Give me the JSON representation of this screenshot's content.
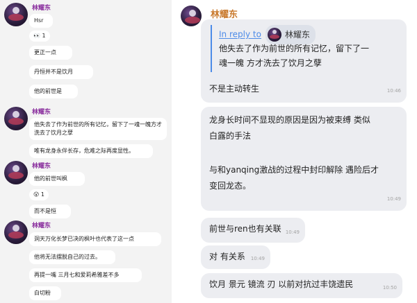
{
  "left": {
    "author": "林耀东",
    "messages": [
      {
        "text": "Hsr"
      },
      {
        "text": "更正一点"
      },
      {
        "text": "丹恒并不是饮月"
      },
      {
        "text": "他的前世是"
      },
      {
        "text": "他失去了作为前世的所有记忆，留下了一魂一魄方才洗去了饮月之孽"
      },
      {
        "text": "唯有龙身永伴长存，危难之际再度显性。"
      },
      {
        "text": "他的前世叫枫"
      },
      {
        "text": "而不是恒"
      },
      {
        "text": "洞天万化长梦已决的枫叶也代表了这一点"
      },
      {
        "text": "他将无法摆脱自己的过去。"
      },
      {
        "text": "再提一嘴 三月七和爱莉希雅差不多"
      },
      {
        "text": "白切粉"
      }
    ],
    "reactions": [
      {
        "icon": "eyes-emoji-icon",
        "glyph": "👀",
        "count": "1"
      },
      {
        "icon": "surprised-face-icon",
        "glyph": "😮",
        "count": "1"
      }
    ]
  },
  "right": {
    "author": "林耀东",
    "reply_label": "In reply to",
    "reply_author": "林耀东",
    "quoted_text_line1": "他失去了作为前世的所有记忆，留下了一",
    "quoted_text_line2": "魂一魄 方才洗去了饮月之孽",
    "messages": [
      {
        "text": "不是主动转生",
        "time": "10:46"
      },
      {
        "line1": "龙身长时间不显现的原因是因为被束缚 类似",
        "line2": "白露的手法",
        "line3": "与和yanqing激战的过程中封印解除 遇险后才",
        "line4": "变回龙态。",
        "time": "10:49"
      },
      {
        "text": "前世与ren也有关联",
        "time": "10:49"
      },
      {
        "text": "对 有关系",
        "time": "10:49"
      },
      {
        "text": "饮月 景元 镜流 刃 以前对抗过丰饶遗民",
        "time": "10:50"
      }
    ]
  }
}
